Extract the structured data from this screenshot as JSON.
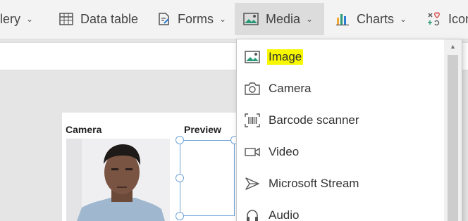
{
  "ribbon": {
    "items": [
      {
        "label": "llery",
        "icon": "gallery-icon"
      },
      {
        "label": "Data table",
        "icon": "table-icon"
      },
      {
        "label": "Forms",
        "icon": "form-icon"
      },
      {
        "label": "Media",
        "icon": "media-image-icon"
      },
      {
        "label": "Charts",
        "icon": "chart-icon"
      },
      {
        "label": "Icon",
        "icon": "icons-icon"
      }
    ]
  },
  "screen": {
    "camera_label": "Camera",
    "preview_label": "Preview"
  },
  "menu": {
    "items": [
      {
        "label": "Image",
        "icon": "image-icon",
        "highlighted": true
      },
      {
        "label": "Camera",
        "icon": "camera-icon"
      },
      {
        "label": "Barcode scanner",
        "icon": "barcode-icon"
      },
      {
        "label": "Video",
        "icon": "video-icon"
      },
      {
        "label": "Microsoft Stream",
        "icon": "stream-icon"
      },
      {
        "label": "Audio",
        "icon": "headphones-icon"
      }
    ]
  },
  "colors": {
    "highlight": "#f7f700",
    "selection": "#6ea3d8",
    "ribbon_bg": "#f3f3f3",
    "active_tab_bg": "#dcdcdc"
  }
}
